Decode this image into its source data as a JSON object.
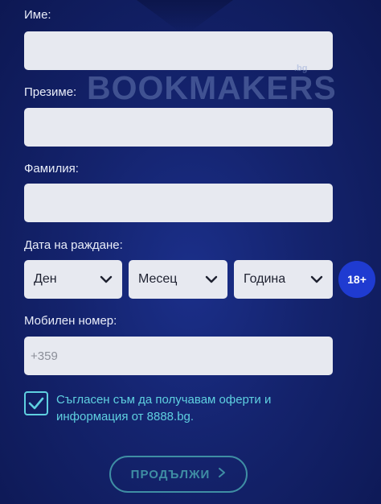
{
  "form": {
    "first_name_label": "Име:",
    "middle_name_label": "Презиме:",
    "last_name_label": "Фамилия:",
    "birth_date_label": "Дата на раждане:",
    "day_select": "Ден",
    "month_select": "Месец",
    "year_select": "Година",
    "age_badge": "18+",
    "phone_label": "Мобилен номер:",
    "phone_placeholder": "+359",
    "consent_text": "Съгласен съм да получавам оферти и информация от 8888.bg.",
    "consent_checked": true,
    "continue_button": "ПРОДЪЛЖИ"
  },
  "watermark": {
    "text": "BOOKMAKERS",
    "tld": ".bg"
  },
  "colors": {
    "background": "#14236d",
    "input_bg": "#e7e9f0",
    "accent_cyan": "#5fd0e0",
    "badge_blue": "#1f3bd1",
    "button_outline": "#3f8ea4"
  }
}
